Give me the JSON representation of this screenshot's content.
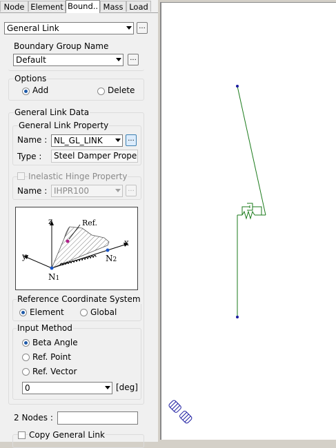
{
  "tabs": [
    "Node",
    "Element",
    "Bound..",
    "Mass",
    "Load"
  ],
  "active_tab_index": 2,
  "command": {
    "selected": "General Link",
    "button": "..."
  },
  "boundary_group": {
    "label": "Boundary Group Name",
    "value": "Default",
    "button": "..."
  },
  "options": {
    "label": "Options",
    "add_label": "Add",
    "delete_label": "Delete",
    "selected": "Add"
  },
  "link_data": {
    "label": "General Link Data",
    "property_label": "General Link Property",
    "name_label": "Name :",
    "name_value": "NL_GL_LINK",
    "name_button": "...",
    "type_label": "Type :",
    "type_value": "Steel Damper Propert"
  },
  "hinge": {
    "label": "Inelastic Hinge Property",
    "checked": false,
    "name_label": "Name :",
    "name_value": "IHPR100",
    "button": "..."
  },
  "diagram": {
    "z": "z",
    "ref": "Ref.",
    "x": "x",
    "y": "y",
    "n1": "N",
    "n1_sub": "1",
    "n2": "N",
    "n2_sub": "2"
  },
  "ref_coord": {
    "label": "Reference Coordinate System",
    "element_label": "Element",
    "global_label": "Global",
    "selected": "Element"
  },
  "input_method": {
    "label": "Input Method",
    "beta_label": "Beta Angle",
    "refpoint_label": "Ref. Point",
    "refvector_label": "Ref. Vector",
    "selected": "Beta Angle",
    "angle_value": "0",
    "unit": "[deg]"
  },
  "nodes": {
    "label": "2 Nodes :",
    "value": ""
  },
  "copy": {
    "label": "Copy General Link",
    "checked": false
  },
  "colors": {
    "model_line": "#1a7a1a",
    "node": "#1a1aa0",
    "active_radio": "#1e5aa8"
  }
}
